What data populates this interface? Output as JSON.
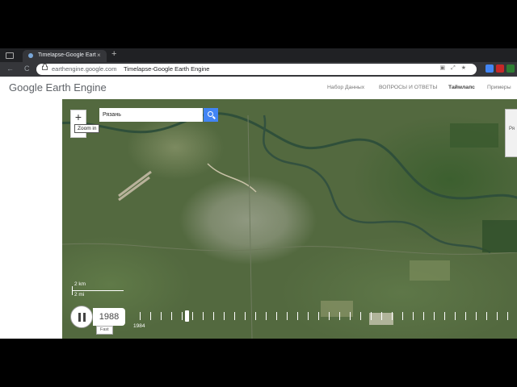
{
  "browser": {
    "tab_title": "Timelapse-Google Earth",
    "tab_close": "×",
    "new_tab": "+",
    "back": "←",
    "forward": "→",
    "reload": "C",
    "url": "earthengine.google.com",
    "page_title": "Timelapse-Google Earth Engine",
    "extensions": [
      "#4285f4",
      "#c62828",
      "#2e7d32"
    ]
  },
  "site": {
    "logo": "Google Earth Engine",
    "nav": [
      "Набор Данных",
      "ВОПРОСЫ И ОТВЕТЫ",
      "Таймлапс",
      "Примеры"
    ],
    "active_nav": "Таймлапс"
  },
  "map": {
    "zoom_in": "+",
    "zoom_tooltip": "Zoom in",
    "search_value": "Рязань",
    "side_panel": "Ря",
    "scale": {
      "km": "2 km",
      "mi": "2 mi"
    }
  },
  "timeline": {
    "year": "1988",
    "speed": "Fast",
    "start_year": "1984",
    "progress": 0.1
  }
}
